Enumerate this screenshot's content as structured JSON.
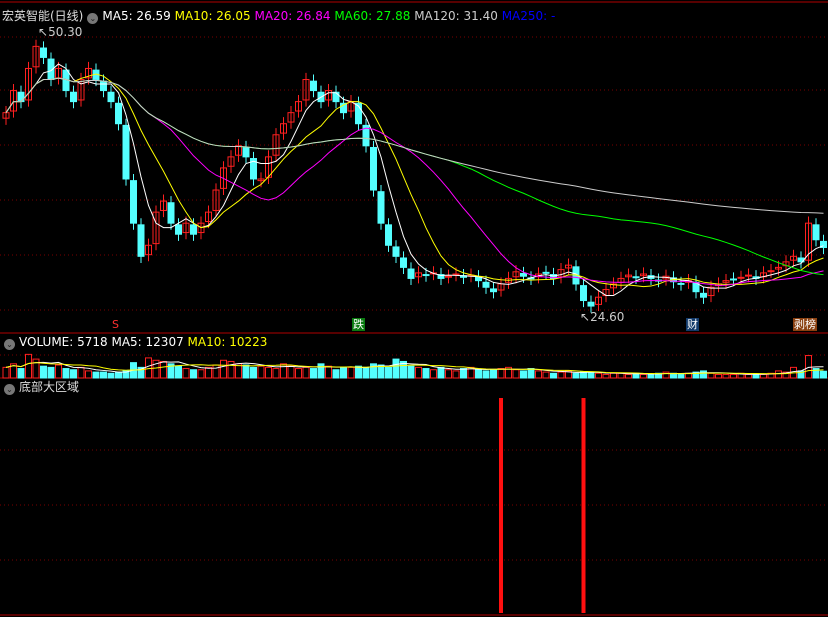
{
  "title": "宏英智能(日线)",
  "main_legend": [
    {
      "label": "MA5: 26.59",
      "color": "#ffffff"
    },
    {
      "label": "MA10: 26.05",
      "color": "#ffff00"
    },
    {
      "label": "MA20: 26.84",
      "color": "#ff00ff"
    },
    {
      "label": "MA60: 27.88",
      "color": "#00ff00"
    },
    {
      "label": "MA120: 31.40",
      "color": "#cccccc"
    },
    {
      "label": "MA250: -",
      "color": "#0000ff"
    }
  ],
  "high_label": "50.30",
  "low_label": "24.60",
  "markers": {
    "s": "S",
    "die": "跌",
    "cai": "财",
    "bang": "剥榜"
  },
  "volume_legend": {
    "volume": "VOLUME: 5718",
    "ma5": "MA5: 12307",
    "ma10": "MA10: 10223"
  },
  "indicator_title": "底部大区域",
  "colors": {
    "up": "#ff2020",
    "down": "#54ffff",
    "grid": "#7a0000",
    "border": "#b00000"
  },
  "chart_data": {
    "type": "candlestick",
    "price_range": [
      24.6,
      50.3
    ],
    "closes": [
      43,
      45,
      44,
      47,
      49,
      48,
      46,
      47,
      45,
      44,
      46,
      47,
      46,
      45,
      44,
      42,
      37,
      33,
      30,
      31,
      34,
      35,
      33,
      32,
      33,
      32,
      33,
      34,
      36,
      38,
      39,
      40,
      39,
      37,
      37,
      39,
      41,
      42,
      43,
      44,
      46,
      45,
      44,
      45,
      44,
      43,
      44,
      42,
      40,
      36,
      33,
      31,
      30,
      29,
      28,
      28.5,
      28.3,
      28.5,
      28,
      28.2,
      28.4,
      28.1,
      28.3,
      27.8,
      27.2,
      26.8,
      27.5,
      28,
      28.6,
      28.2,
      28,
      28.4,
      28.5,
      28,
      28.8,
      29.2,
      27.5,
      26,
      25.5,
      26.3,
      27,
      27.5,
      28,
      28.3,
      28.1,
      28.4,
      28,
      27.8,
      28.2,
      27.7,
      27.5,
      27.8,
      26.8,
      26.3,
      27.2,
      27.5,
      27.8,
      27.9,
      28.1,
      28.3,
      28,
      28.5,
      28.7,
      29,
      29.5,
      30,
      29.5,
      33,
      31.5,
      30.8
    ],
    "volumes": [
      9000,
      12000,
      8000,
      20000,
      16000,
      10000,
      9000,
      11000,
      8000,
      7000,
      9000,
      6000,
      5000,
      5000,
      4000,
      5000,
      6000,
      13000,
      9000,
      17000,
      15000,
      14000,
      12000,
      10000,
      8000,
      7000,
      7000,
      9000,
      11000,
      15000,
      14000,
      12000,
      11000,
      9000,
      10000,
      9000,
      8000,
      12000,
      10000,
      8000,
      9000,
      8000,
      12000,
      10000,
      7000,
      9000,
      9000,
      10000,
      9000,
      12000,
      11000,
      9000,
      16000,
      14000,
      10000,
      9000,
      8000,
      7000,
      9000,
      7000,
      6000,
      8000,
      9000,
      7000,
      6000,
      7000,
      8000,
      9000,
      7000,
      6000,
      8000,
      6000,
      5000,
      4000,
      5000,
      6000,
      4000,
      5000,
      5000,
      4000,
      3000,
      4000,
      4000,
      3000,
      4000,
      3000,
      3000,
      4000,
      5000,
      4000,
      3000,
      4000,
      5000,
      6000,
      4000,
      3000,
      3000,
      3000,
      4000,
      3000,
      3000,
      3000,
      4000,
      6000,
      5000,
      9000,
      6000,
      19000,
      8000,
      5718
    ],
    "signal_indices": [
      66,
      77
    ],
    "volume_range": [
      0,
      22000
    ]
  }
}
